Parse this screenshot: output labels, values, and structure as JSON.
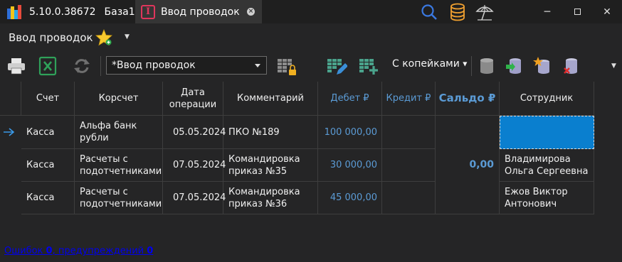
{
  "titlebar": {
    "app_version": "5.10.0.38672",
    "db_name": "База1",
    "active_tab": "Ввод проводок",
    "tab_icon_letter": "I"
  },
  "menu": {
    "title": "Ввод проводок"
  },
  "toolbar": {
    "combo_value": "*Ввод проводок",
    "currency_mode": "С копейками"
  },
  "table": {
    "headers": {
      "account": "Счет",
      "corr_account": "Корсчет",
      "date": "Дата операции",
      "comment": "Комментарий",
      "debit": "Дебет ₽",
      "credit": "Кредит ₽",
      "balance": "Сальдо ₽",
      "employee": "Сотрудник"
    },
    "rows": [
      {
        "account": "Касса",
        "corr_account": "Альфа банк рубли",
        "date": "05.05.2024",
        "comment": "ПКО №189",
        "debit": "100 000,00",
        "credit": "",
        "employee": ""
      },
      {
        "account": "Касса",
        "corr_account": "Расчеты с подотчетниками",
        "date": "07.05.2024",
        "comment": "Командировка приказ №35",
        "debit": "30 000,00",
        "credit": "",
        "employee": "Владимирова Ольга Сергеевна"
      },
      {
        "account": "Касса",
        "corr_account": "Расчеты с подотчетниками",
        "date": "07.05.2024",
        "comment": "Командировка приказ №36",
        "debit": "45 000,00",
        "credit": "",
        "employee": "Ежов Виктор Антонович"
      }
    ],
    "balance_value": "0,00"
  },
  "footer": {
    "errors_label": "Ошибок",
    "errors_count": "0",
    "warnings_label": "предупреждений",
    "warnings_count": "0"
  },
  "colors": {
    "accent_blue": "#5b9bd5",
    "selection": "#0a7fcf",
    "tab_icon": "#e0365c"
  }
}
